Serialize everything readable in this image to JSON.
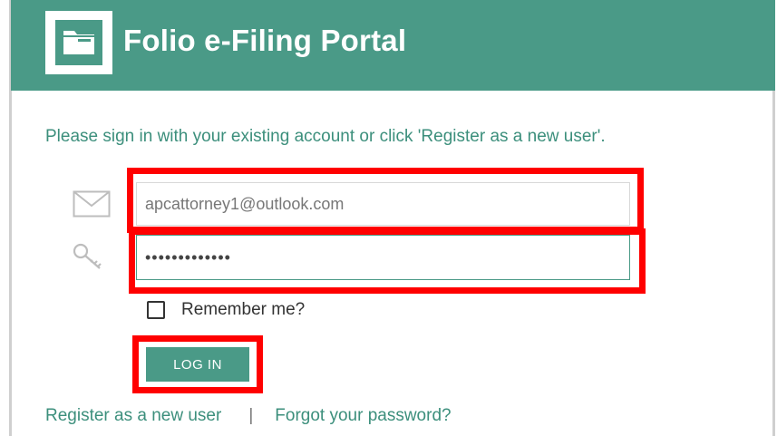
{
  "header": {
    "title": "Folio e-Filing Portal",
    "logo_icon": "folder-icon"
  },
  "intro_text": "Please sign in with your existing account or click 'Register as a new user'.",
  "email_field": {
    "value": "apcattorney1@outlook.com",
    "icon": "envelope-icon"
  },
  "password_field": {
    "value": "•••••••••••••",
    "icon": "key-icon"
  },
  "remember": {
    "label": "Remember me?",
    "checked": false
  },
  "login_button": {
    "label": "LOG IN"
  },
  "links": {
    "register": "Register as a new user",
    "separator": "|",
    "forgot": "Forgot your password?"
  },
  "colors": {
    "brand": "#4a9a87",
    "highlight": "#ff0000"
  }
}
